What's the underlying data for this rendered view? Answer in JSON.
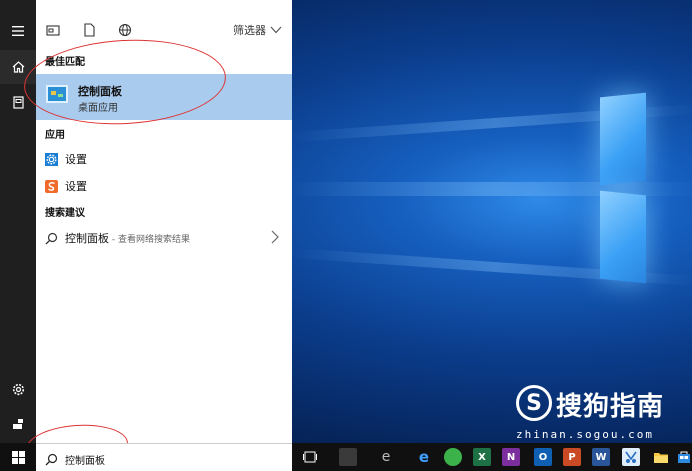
{
  "topbar": {
    "filter_label": "筛选器"
  },
  "sections": {
    "best_match": "最佳匹配",
    "apps": "应用",
    "suggestions": "搜索建议"
  },
  "best_match": {
    "name": "控制面板",
    "subtitle": "桌面应用"
  },
  "apps": [
    {
      "label": "设置",
      "icon": "gear-icon"
    },
    {
      "label": "设置",
      "icon": "settings-s-icon"
    }
  ],
  "suggestion": {
    "term": "控制面板",
    "hint": " - 查看网络搜索结果"
  },
  "search": {
    "value": "控制面板"
  },
  "taskbar_apps": [
    {
      "name": "task-view",
      "label": ""
    },
    {
      "name": "app-dark",
      "label": ""
    },
    {
      "name": "ie",
      "label": "e"
    },
    {
      "name": "edge",
      "label": "e"
    },
    {
      "name": "360-browser",
      "label": ""
    },
    {
      "name": "excel",
      "label": "X"
    },
    {
      "name": "onenote",
      "label": "N"
    },
    {
      "name": "outlook",
      "label": "O"
    },
    {
      "name": "powerpoint",
      "label": "P"
    },
    {
      "name": "word",
      "label": "W"
    },
    {
      "name": "snipping",
      "label": ""
    },
    {
      "name": "explorer",
      "label": ""
    },
    {
      "name": "store",
      "label": ""
    }
  ],
  "watermark": {
    "logo_letter": "S",
    "name": "搜狗指南",
    "url": "zhinan.sogou.com"
  },
  "colors": {
    "accent": "#a9cbee",
    "annotation": "#dd3333"
  }
}
